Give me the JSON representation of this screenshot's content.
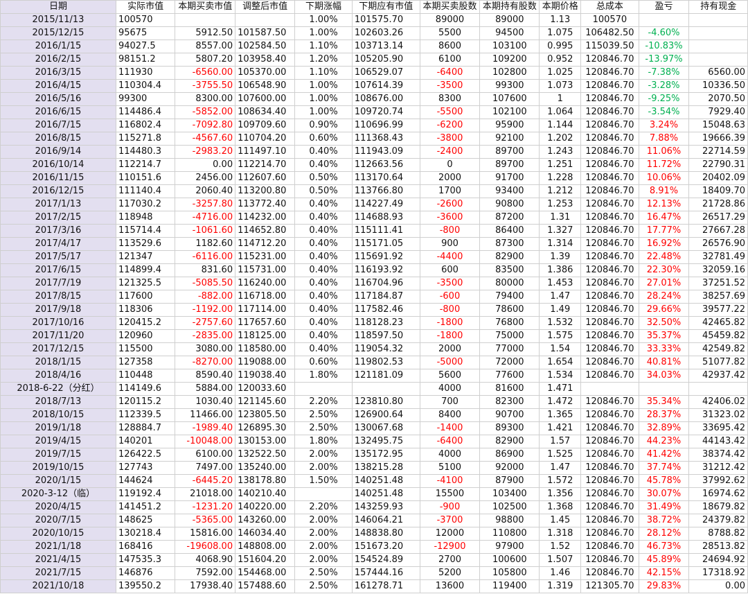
{
  "columns": [
    "日期",
    "实际市值",
    "本期买卖市值",
    "调整后市值",
    "下期涨幅",
    "下期应有市值",
    "本期买卖股数",
    "本期持有股数",
    "本期价格",
    "总成本",
    "盈亏",
    "持有现金"
  ],
  "colors": {
    "negative": "#ff0000",
    "positive_pl": "#ff0000",
    "negative_pl": "#00b050",
    "date_fill": "#e3dff0"
  },
  "rows": [
    [
      "2015/11/13",
      "100570",
      "",
      "",
      "1.00%",
      "101575.70",
      "89000",
      "89000",
      "1.13",
      "100570",
      "",
      ""
    ],
    [
      "2015/12/15",
      "95675",
      "5912.50",
      "101587.50",
      "1.00%",
      "102603.26",
      "5500",
      "94500",
      "1.075",
      "106482.50",
      "-4.60%",
      ""
    ],
    [
      "2016/1/15",
      "94027.5",
      "8557.00",
      "102584.50",
      "1.10%",
      "103713.14",
      "8600",
      "103100",
      "0.995",
      "115039.50",
      "-10.83%",
      ""
    ],
    [
      "2016/2/15",
      "98151.2",
      "5807.20",
      "103958.40",
      "1.20%",
      "105205.90",
      "6100",
      "109200",
      "0.952",
      "120846.70",
      "-13.97%",
      ""
    ],
    [
      "2016/3/15",
      "111930",
      "-6560.00",
      "105370.00",
      "1.10%",
      "106529.07",
      "-6400",
      "102800",
      "1.025",
      "120846.70",
      "-7.38%",
      "6560.00"
    ],
    [
      "2016/4/15",
      "110304.4",
      "-3755.50",
      "106548.90",
      "1.00%",
      "107614.39",
      "-3500",
      "99300",
      "1.073",
      "120846.70",
      "-3.28%",
      "10336.50"
    ],
    [
      "2016/5/16",
      "99300",
      "8300.00",
      "107600.00",
      "1.00%",
      "108676.00",
      "8300",
      "107600",
      "1",
      "120846.70",
      "-9.25%",
      "2070.50"
    ],
    [
      "2016/6/15",
      "114486.4",
      "-5852.00",
      "108634.40",
      "1.00%",
      "109720.74",
      "-5500",
      "102100",
      "1.064",
      "120846.70",
      "-3.54%",
      "7929.40"
    ],
    [
      "2016/7/15",
      "116802.4",
      "-7092.80",
      "109709.60",
      "0.90%",
      "110696.99",
      "-6200",
      "95900",
      "1.144",
      "120846.70",
      "3.24%",
      "15048.63"
    ],
    [
      "2016/8/15",
      "115271.8",
      "-4567.60",
      "110704.20",
      "0.60%",
      "111368.43",
      "-3800",
      "92100",
      "1.202",
      "120846.70",
      "7.88%",
      "19666.39"
    ],
    [
      "2016/9/14",
      "114480.3",
      "-2983.20",
      "111497.10",
      "0.40%",
      "111943.09",
      "-2400",
      "89700",
      "1.243",
      "120846.70",
      "11.06%",
      "22714.59"
    ],
    [
      "2016/10/14",
      "112214.7",
      "0.00",
      "112214.70",
      "0.40%",
      "112663.56",
      "0",
      "89700",
      "1.251",
      "120846.70",
      "11.72%",
      "22790.31"
    ],
    [
      "2016/11/15",
      "110151.6",
      "2456.00",
      "112607.60",
      "0.50%",
      "113170.64",
      "2000",
      "91700",
      "1.228",
      "120846.70",
      "10.06%",
      "20402.09"
    ],
    [
      "2016/12/15",
      "111140.4",
      "2060.40",
      "113200.80",
      "0.50%",
      "113766.80",
      "1700",
      "93400",
      "1.212",
      "120846.70",
      "8.91%",
      "18409.70"
    ],
    [
      "2017/1/13",
      "117030.2",
      "-3257.80",
      "113772.40",
      "0.40%",
      "114227.49",
      "-2600",
      "90800",
      "1.253",
      "120846.70",
      "12.13%",
      "21728.86"
    ],
    [
      "2017/2/15",
      "118948",
      "-4716.00",
      "114232.00",
      "0.40%",
      "114688.93",
      "-3600",
      "87200",
      "1.31",
      "120846.70",
      "16.47%",
      "26517.29"
    ],
    [
      "2017/3/16",
      "115714.4",
      "-1061.60",
      "114652.80",
      "0.40%",
      "115111.41",
      "-800",
      "86400",
      "1.327",
      "120846.70",
      "17.77%",
      "27667.28"
    ],
    [
      "2017/4/17",
      "113529.6",
      "1182.60",
      "114712.20",
      "0.40%",
      "115171.05",
      "900",
      "87300",
      "1.314",
      "120846.70",
      "16.92%",
      "26576.90"
    ],
    [
      "2017/5/17",
      "121347",
      "-6116.00",
      "115231.00",
      "0.40%",
      "115691.92",
      "-4400",
      "82900",
      "1.39",
      "120846.70",
      "22.48%",
      "32781.49"
    ],
    [
      "2017/6/15",
      "114899.4",
      "831.60",
      "115731.00",
      "0.40%",
      "116193.92",
      "600",
      "83500",
      "1.386",
      "120846.70",
      "22.30%",
      "32059.16"
    ],
    [
      "2017/7/19",
      "121325.5",
      "-5085.50",
      "116240.00",
      "0.40%",
      "116704.96",
      "-3500",
      "80000",
      "1.453",
      "120846.70",
      "27.01%",
      "37251.52"
    ],
    [
      "2017/8/15",
      "117600",
      "-882.00",
      "116718.00",
      "0.40%",
      "117184.87",
      "-600",
      "79400",
      "1.47",
      "120846.70",
      "28.24%",
      "38257.69"
    ],
    [
      "2017/9/18",
      "118306",
      "-1192.00",
      "117114.00",
      "0.40%",
      "117582.46",
      "-800",
      "78600",
      "1.49",
      "120846.70",
      "29.66%",
      "39577.22"
    ],
    [
      "2017/10/16",
      "120415.2",
      "-2757.60",
      "117657.60",
      "0.40%",
      "118128.23",
      "-1800",
      "76800",
      "1.532",
      "120846.70",
      "32.50%",
      "42465.82"
    ],
    [
      "2017/11/20",
      "120960",
      "-2835.00",
      "118125.00",
      "0.40%",
      "118597.50",
      "-1800",
      "75000",
      "1.575",
      "120846.70",
      "35.37%",
      "45459.82"
    ],
    [
      "2017/12/15",
      "115500",
      "3080.00",
      "118580.00",
      "0.40%",
      "119054.32",
      "2000",
      "77000",
      "1.54",
      "120846.70",
      "33.33%",
      "42549.82"
    ],
    [
      "2018/1/15",
      "127358",
      "-8270.00",
      "119088.00",
      "0.60%",
      "119802.53",
      "-5000",
      "72000",
      "1.654",
      "120846.70",
      "40.81%",
      "51077.82"
    ],
    [
      "2018/4/16",
      "110448",
      "8590.40",
      "119038.40",
      "1.80%",
      "121181.09",
      "5600",
      "77600",
      "1.534",
      "120846.70",
      "34.03%",
      "42937.42"
    ],
    [
      "2018-6-22（分红）",
      "114149.6",
      "5884.00",
      "120033.60",
      "",
      "",
      "4000",
      "81600",
      "1.471",
      "",
      "",
      ""
    ],
    [
      "2018/7/13",
      "120115.2",
      "1030.40",
      "121145.60",
      "2.20%",
      "123810.80",
      "700",
      "82300",
      "1.472",
      "120846.70",
      "35.34%",
      "42406.02"
    ],
    [
      "2018/10/15",
      "112339.5",
      "11466.00",
      "123805.50",
      "2.50%",
      "126900.64",
      "8400",
      "90700",
      "1.365",
      "120846.70",
      "28.37%",
      "31323.02"
    ],
    [
      "2019/1/18",
      "128884.7",
      "-1989.40",
      "126895.30",
      "2.50%",
      "130067.68",
      "-1400",
      "89300",
      "1.421",
      "120846.70",
      "32.89%",
      "33695.42"
    ],
    [
      "2019/4/15",
      "140201",
      "-10048.00",
      "130153.00",
      "1.80%",
      "132495.75",
      "-6400",
      "82900",
      "1.57",
      "120846.70",
      "44.23%",
      "44143.42"
    ],
    [
      "2019/7/15",
      "126422.5",
      "6100.00",
      "132522.50",
      "2.00%",
      "135172.95",
      "4000",
      "86900",
      "1.525",
      "120846.70",
      "41.42%",
      "38374.42"
    ],
    [
      "2019/10/15",
      "127743",
      "7497.00",
      "135240.00",
      "2.00%",
      "138215.28",
      "5100",
      "92000",
      "1.47",
      "120846.70",
      "37.74%",
      "31212.42"
    ],
    [
      "2020/1/15",
      "144624",
      "-6445.20",
      "138178.80",
      "1.50%",
      "140251.48",
      "-4100",
      "87900",
      "1.572",
      "120846.70",
      "45.78%",
      "37992.62"
    ],
    [
      "2020-3-12（临）",
      "119192.4",
      "21018.00",
      "140210.40",
      "",
      "140251.48",
      "15500",
      "103400",
      "1.356",
      "120846.70",
      "30.07%",
      "16974.62"
    ],
    [
      "2020/4/15",
      "141451.2",
      "-1231.20",
      "140220.00",
      "2.20%",
      "143259.93",
      "-900",
      "102500",
      "1.368",
      "120846.70",
      "31.49%",
      "18679.82"
    ],
    [
      "2020/7/15",
      "148625",
      "-5365.00",
      "143260.00",
      "2.00%",
      "146064.21",
      "-3700",
      "98800",
      "1.45",
      "120846.70",
      "38.72%",
      "24379.82"
    ],
    [
      "2020/10/15",
      "130218.4",
      "15816.00",
      "146034.40",
      "2.00%",
      "148838.80",
      "12000",
      "110800",
      "1.318",
      "120846.70",
      "28.12%",
      "8788.82"
    ],
    [
      "2021/1/18",
      "168416",
      "-19608.00",
      "148808.00",
      "2.00%",
      "151673.20",
      "-12900",
      "97900",
      "1.52",
      "120846.70",
      "46.73%",
      "28513.82"
    ],
    [
      "2021/4/15",
      "147535.3",
      "4068.90",
      "151604.20",
      "2.00%",
      "154524.89",
      "2700",
      "100600",
      "1.507",
      "120846.70",
      "45.89%",
      "24694.92"
    ],
    [
      "2021/7/15",
      "146876",
      "7592.00",
      "154468.00",
      "2.50%",
      "157444.16",
      "5200",
      "105800",
      "1.46",
      "120846.70",
      "42.15%",
      "17318.92"
    ],
    [
      "2021/10/18",
      "139550.2",
      "17938.40",
      "157488.60",
      "2.50%",
      "161278.71",
      "13600",
      "119400",
      "1.319",
      "121305.70",
      "29.83%",
      "0.00"
    ]
  ]
}
